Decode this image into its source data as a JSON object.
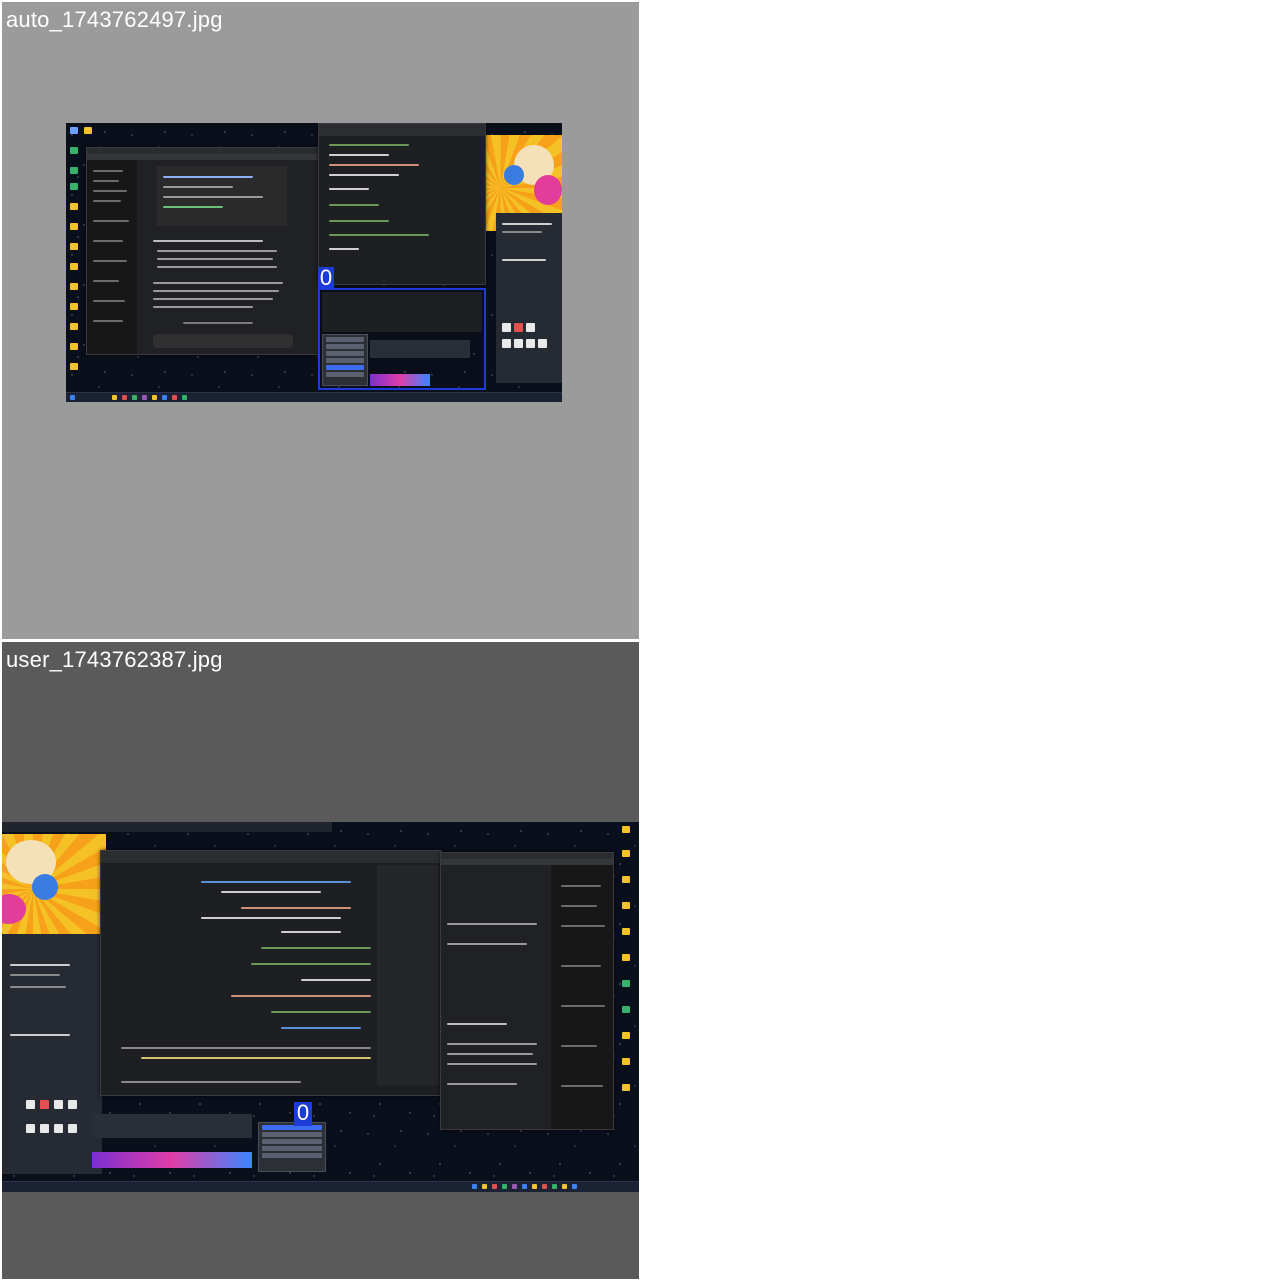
{
  "panels": [
    {
      "label": "auto_1743762497.jpg",
      "marker": "0"
    },
    {
      "label": "user_1743762387.jpg",
      "marker": "0"
    }
  ],
  "colors": {
    "panel_top_bg": "#9b9b9b",
    "panel_bottom_bg": "#5a5a5a",
    "marker_blue": "#1d3bd6",
    "label_text": "#ffffff",
    "desktop_bg": "#0a0f1c",
    "wallpaper_orange": "#f7a11a"
  }
}
